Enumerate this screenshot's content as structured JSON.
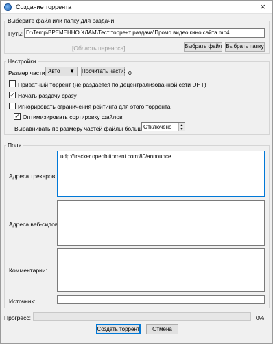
{
  "window": {
    "title": "Создание торрента",
    "close_icon": "×"
  },
  "source": {
    "group_title": "Выберите файл или папку для раздачи",
    "path_label": "Путь:",
    "path_value": "D:\\Temp\\ВРЕМЕННО ХЛАМ\\Тест торрент раздача\\Промо видео кино сайта.mp4",
    "drop_area": "[Область переноса]",
    "select_file_label": "Выбрать файл",
    "select_folder_label": "Выбрать папку"
  },
  "settings": {
    "group_title": "Настройки",
    "piece_size_label": "Размер части:",
    "piece_size_value": "Авто",
    "calc_pieces_label": "Посчитать части:",
    "pieces_count": "0",
    "private_label": "Приватный торрент (не раздаётся по децентрализованной сети DHT)",
    "private_checked": false,
    "start_seeding_label": "Начать раздачу сразу",
    "start_seeding_checked": true,
    "ignore_ratio_label": "Игнорировать ограничения рейтинга для этого торрента",
    "ignore_ratio_checked": false,
    "optimize_order_label": "Оптимизировать сортировку файлов",
    "optimize_order_checked": true,
    "align_label": "Выравнивать по размеру частей файлы больше чем:",
    "align_value": "Отключено"
  },
  "fields": {
    "group_title": "Поля",
    "trackers_label": "Адреса трекеров:",
    "trackers_value": "udp://tracker.openbittorrent.com:80/announce",
    "webseeds_label": "Адреса веб-сидов:",
    "webseeds_value": "",
    "comments_label": "Комментарии:",
    "comments_value": "",
    "source_label": "Источник:",
    "source_value": ""
  },
  "progress": {
    "label": "Прогресс:",
    "percent_text": "0%",
    "value": 0
  },
  "actions": {
    "create_label": "Создать торрент",
    "cancel_label": "Отмена"
  },
  "colors": {
    "accent": "#0078d7",
    "progress_fill": "#06b025"
  },
  "glyphs": {
    "check_mark": "✓",
    "dropdown_arrow": "▼",
    "spin_up": "▲",
    "spin_down": "▼"
  }
}
